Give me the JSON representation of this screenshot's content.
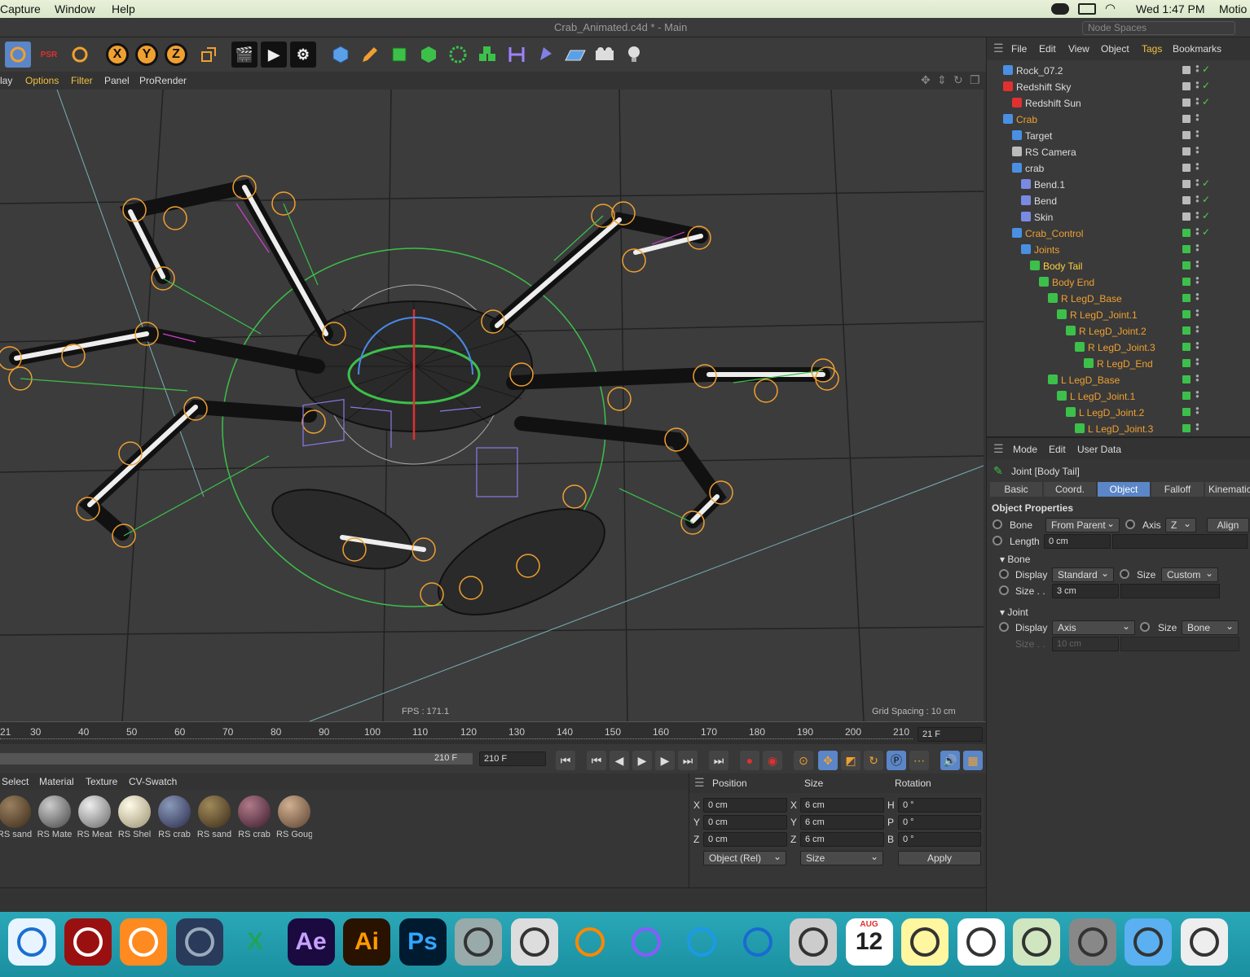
{
  "menubar": {
    "items": [
      "Capture",
      "Window",
      "Help"
    ],
    "clock": "Wed 1:47 PM",
    "right_app": "Motio"
  },
  "titlebar": {
    "title": "Crab_Animated.c4d * - Main",
    "node_spaces": "Node Spaces"
  },
  "viewport_menu": [
    "lay",
    "Options",
    "Filter",
    "Panel",
    "ProRender"
  ],
  "viewport": {
    "fps": "FPS : 171.1",
    "grid_spacing": "Grid Spacing : 10 cm"
  },
  "timeline": {
    "ticks": [
      "21",
      "30",
      "40",
      "50",
      "60",
      "70",
      "80",
      "90",
      "100",
      "110",
      "120",
      "130",
      "140",
      "150",
      "160",
      "170",
      "180",
      "190",
      "200",
      "210"
    ],
    "current_frame": "21 F",
    "end_frame_left": "210 F",
    "end_frame_field": "210 F"
  },
  "material_manager": {
    "menu": [
      "Select",
      "Material",
      "Texture",
      "CV-Swatch"
    ],
    "materials": [
      {
        "label": "RS sand",
        "color": "#5a4a30"
      },
      {
        "label": "RS Mate",
        "color": "#8a8a8a"
      },
      {
        "label": "RS Meat",
        "color": "#b5b5b5"
      },
      {
        "label": "RS Shel",
        "color": "#e8e4d0"
      },
      {
        "label": "RS crab",
        "color": "#5a6a8a"
      },
      {
        "label": "RS sand",
        "color": "#6a5a3a"
      },
      {
        "label": "RS crab",
        "color": "#7a4a5a"
      },
      {
        "label": "RS Goug",
        "color": "#a08060"
      }
    ]
  },
  "coord_manager": {
    "headers": {
      "position": "Position",
      "size": "Size",
      "rotation": "Rotation"
    },
    "rows": [
      {
        "axis": "X",
        "pos": "0 cm",
        "size_axis": "X",
        "size": "6 cm",
        "rot_axis": "H",
        "rot": "0 °"
      },
      {
        "axis": "Y",
        "pos": "0 cm",
        "size_axis": "Y",
        "size": "6 cm",
        "rot_axis": "P",
        "rot": "0 °"
      },
      {
        "axis": "Z",
        "pos": "0 cm",
        "size_axis": "Z",
        "size": "6 cm",
        "rot_axis": "B",
        "rot": "0 °"
      }
    ],
    "mode": "Object (Rel)",
    "size_mode": "Size",
    "apply": "Apply"
  },
  "object_manager": {
    "menu": [
      "File",
      "Edit",
      "View",
      "Object",
      "Tags",
      "Bookmarks"
    ],
    "items": [
      {
        "name": "Rock_07.2",
        "indent": 0,
        "color": "#dddddd",
        "icon": "#4a90e2",
        "vis": "grey",
        "check": true
      },
      {
        "name": "Redshift Sky",
        "indent": 0,
        "color": "#dddddd",
        "icon": "#e03030",
        "vis": "grey",
        "check": true
      },
      {
        "name": "Redshift Sun",
        "indent": 1,
        "color": "#dddddd",
        "icon": "#e03030",
        "vis": "grey",
        "check": true
      },
      {
        "name": "Crab",
        "indent": 0,
        "color": "#f0a030",
        "icon": "#4a90e2",
        "vis": "grey",
        "check": false
      },
      {
        "name": "Target",
        "indent": 1,
        "color": "#dddddd",
        "icon": "#4a90e2",
        "vis": "grey",
        "check": false
      },
      {
        "name": "RS Camera",
        "indent": 1,
        "color": "#dddddd",
        "icon": "#bbbbbb",
        "vis": "grey",
        "check": false
      },
      {
        "name": "crab",
        "indent": 1,
        "color": "#dddddd",
        "icon": "#4a90e2",
        "vis": "grey",
        "check": false
      },
      {
        "name": "Bend.1",
        "indent": 2,
        "color": "#dddddd",
        "icon": "#7a8ae2",
        "vis": "grey",
        "check": true
      },
      {
        "name": "Bend",
        "indent": 2,
        "color": "#dddddd",
        "icon": "#7a8ae2",
        "vis": "grey",
        "check": true
      },
      {
        "name": "Skin",
        "indent": 2,
        "color": "#dddddd",
        "icon": "#7a8ae2",
        "vis": "grey",
        "check": true
      },
      {
        "name": "Crab_Control",
        "indent": 1,
        "color": "#f0a030",
        "icon": "#4a90e2",
        "vis": "green",
        "check": true
      },
      {
        "name": "Joints",
        "indent": 2,
        "color": "#f0a030",
        "icon": "#4a90e2",
        "vis": "green",
        "check": false
      },
      {
        "name": "Body Tail",
        "indent": 3,
        "color": "#ffd040",
        "icon": "#3cc04a",
        "vis": "green",
        "check": false
      },
      {
        "name": "Body End",
        "indent": 4,
        "color": "#f0a030",
        "icon": "#3cc04a",
        "vis": "green",
        "check": false
      },
      {
        "name": "R LegD_Base",
        "indent": 5,
        "color": "#f0a030",
        "icon": "#3cc04a",
        "vis": "green",
        "check": false
      },
      {
        "name": "R LegD_Joint.1",
        "indent": 6,
        "color": "#f0a030",
        "icon": "#3cc04a",
        "vis": "green",
        "check": false
      },
      {
        "name": "R LegD_Joint.2",
        "indent": 7,
        "color": "#f0a030",
        "icon": "#3cc04a",
        "vis": "green",
        "check": false
      },
      {
        "name": "R LegD_Joint.3",
        "indent": 8,
        "color": "#f0a030",
        "icon": "#3cc04a",
        "vis": "green",
        "check": false
      },
      {
        "name": "R LegD_End",
        "indent": 9,
        "color": "#f0a030",
        "icon": "#3cc04a",
        "vis": "green",
        "check": false
      },
      {
        "name": "L LegD_Base",
        "indent": 5,
        "color": "#f0a030",
        "icon": "#3cc04a",
        "vis": "green",
        "check": false
      },
      {
        "name": "L LegD_Joint.1",
        "indent": 6,
        "color": "#f0a030",
        "icon": "#3cc04a",
        "vis": "green",
        "check": false
      },
      {
        "name": "L LegD_Joint.2",
        "indent": 7,
        "color": "#f0a030",
        "icon": "#3cc04a",
        "vis": "green",
        "check": false
      },
      {
        "name": "L LegD_Joint.3",
        "indent": 8,
        "color": "#f0a030",
        "icon": "#3cc04a",
        "vis": "green",
        "check": false
      }
    ]
  },
  "attribute_manager": {
    "menu": [
      "Mode",
      "Edit",
      "User Data"
    ],
    "title": "Joint [Body Tail]",
    "tabs": [
      "Basic",
      "Coord.",
      "Object",
      "Falloff",
      "Kinematic"
    ],
    "active_tab": "Object",
    "section_title": "Object Properties",
    "bone_label": "Bone",
    "bone_value": "From Parent",
    "axis_label": "Axis",
    "axis_value": "Z",
    "align_button": "Align",
    "length_label": "Length",
    "length_value": "0 cm",
    "bone_group": "Bone",
    "bone_display_label": "Display",
    "bone_display_value": "Standard",
    "bone_size_label": "Size",
    "bone_size_value": "Custom",
    "bone_size2_label": "Size . .",
    "bone_size2_value": "3 cm",
    "joint_group": "Joint",
    "joint_display_label": "Display",
    "joint_display_value": "Axis",
    "joint_size_label": "Size",
    "joint_size_value": "Bone",
    "joint_size2_label": "Size . .",
    "joint_size2_value": "10 cm"
  },
  "toolbar": {
    "xyz": [
      "X",
      "Y",
      "Z"
    ]
  },
  "dock": {
    "apps": [
      {
        "name": "safari-icon",
        "label": "",
        "bg": "#e8f4ff",
        "fg": "#1a6fd0"
      },
      {
        "name": "acrobat-icon",
        "label": "",
        "bg": "#9a1010",
        "fg": "#fff"
      },
      {
        "name": "firefox-icon",
        "label": "",
        "bg": "#ff8a20",
        "fg": "#fff"
      },
      {
        "name": "cinema4d-icon",
        "label": "",
        "bg": "#2a3a5a",
        "fg": "#9ab"
      },
      {
        "name": "excel-icon",
        "label": "X",
        "bg": "transparent",
        "fg": "#21a35a"
      },
      {
        "name": "after-effects-icon",
        "label": "Ae",
        "bg": "#1a0a40",
        "fg": "#c8a0ff"
      },
      {
        "name": "illustrator-icon",
        "label": "Ai",
        "bg": "#2a1200",
        "fg": "#ff9a00"
      },
      {
        "name": "photoshop-icon",
        "label": "Ps",
        "bg": "#001a30",
        "fg": "#31a8ff"
      },
      {
        "name": "launchpad-icon",
        "label": "",
        "bg": "#9aa",
        "fg": "#333"
      },
      {
        "name": "screenshot-icon",
        "label": "",
        "bg": "#ddd",
        "fg": "#333"
      },
      {
        "name": "vlc-icon",
        "label": "",
        "bg": "transparent",
        "fg": "#ff8800"
      },
      {
        "name": "prime-video-icon",
        "label": "",
        "bg": "transparent",
        "fg": "#8a5aff"
      },
      {
        "name": "quicktime-icon",
        "label": "",
        "bg": "transparent",
        "fg": "#1a9ae8"
      },
      {
        "name": "quicktime-q-icon",
        "label": "",
        "bg": "transparent",
        "fg": "#1a6ad0"
      },
      {
        "name": "calculator-icon",
        "label": "",
        "bg": "#ccc",
        "fg": "#333"
      },
      {
        "name": "calendar-icon",
        "label": "12",
        "bg": "#fff",
        "fg": "#222"
      },
      {
        "name": "notes-icon",
        "label": "",
        "bg": "#fff6a0",
        "fg": "#333"
      },
      {
        "name": "reminders-icon",
        "label": "",
        "bg": "#fff",
        "fg": "#333"
      },
      {
        "name": "maps-icon",
        "label": "",
        "bg": "#cfe6c0",
        "fg": "#333"
      },
      {
        "name": "system-preferences-icon",
        "label": "",
        "bg": "#888",
        "fg": "#333"
      },
      {
        "name": "folder-icon",
        "label": "",
        "bg": "#5ab0f0",
        "fg": "#333"
      },
      {
        "name": "preview-icon",
        "label": "",
        "bg": "#eee",
        "fg": "#333"
      }
    ],
    "calendar_month": "AUG"
  }
}
